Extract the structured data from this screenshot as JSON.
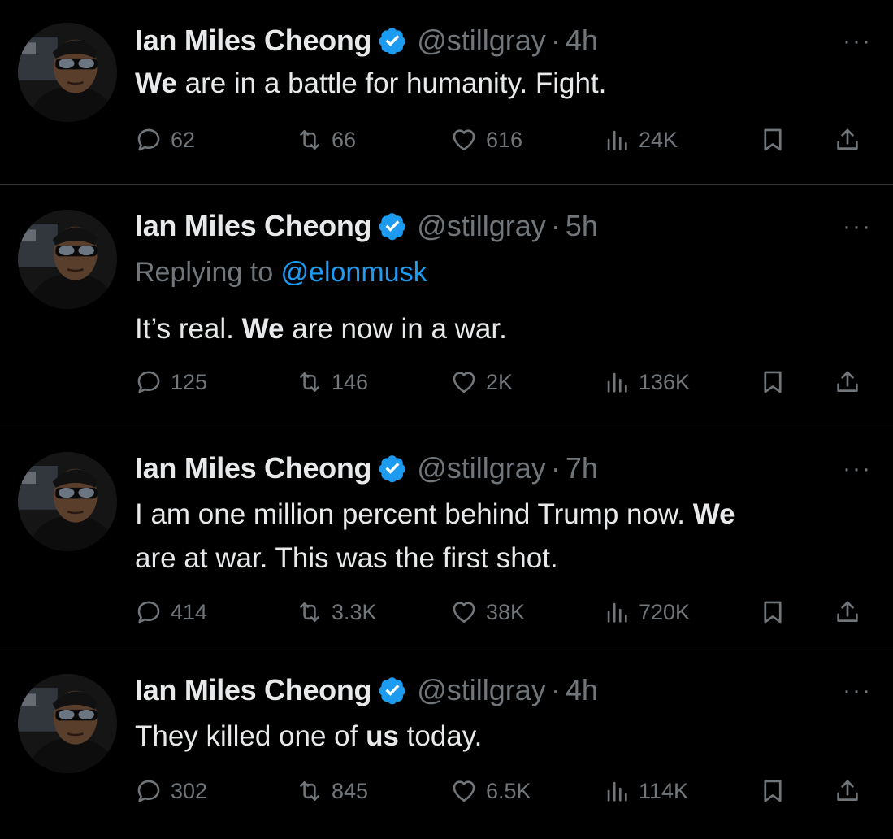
{
  "author": {
    "name": "Ian Miles Cheong",
    "handle": "@stillgray",
    "verified_color": "#1d9bf0"
  },
  "separator": "·",
  "more_label": "···",
  "tweets": [
    {
      "time": "4h",
      "reply_to": null,
      "text_bold_1": "We",
      "text_part_1": " are in a battle for humanity. Fight.",
      "replies": "62",
      "retweets": "66",
      "likes": "616",
      "views": "24K"
    },
    {
      "time": "5h",
      "reply_prefix": "Replying to ",
      "reply_mention": "@elonmusk",
      "text_part_1": "It’s real. ",
      "text_bold_1": "We",
      "text_part_2": " are now in a war.",
      "replies": "125",
      "retweets": "146",
      "likes": "2K",
      "views": "136K"
    },
    {
      "time": "7h",
      "text_part_1": "I am one million percent behind Trump now. ",
      "text_bold_1": "We",
      "text_line_2": "are at war. This was the first shot.",
      "replies": "414",
      "retweets": "3.3K",
      "likes": "38K",
      "views": "720K"
    },
    {
      "time": "4h",
      "text_part_1": "They killed one of ",
      "text_bold_1": "us",
      "text_part_2": " today.",
      "replies": "302",
      "retweets": "845",
      "likes": "6.5K",
      "views": "114K"
    }
  ],
  "icons": {
    "reply": "reply-icon",
    "retweet": "retweet-icon",
    "like": "heart-icon",
    "views": "views-icon",
    "bookmark": "bookmark-icon",
    "share": "share-icon",
    "verified": "verified-badge-icon"
  }
}
